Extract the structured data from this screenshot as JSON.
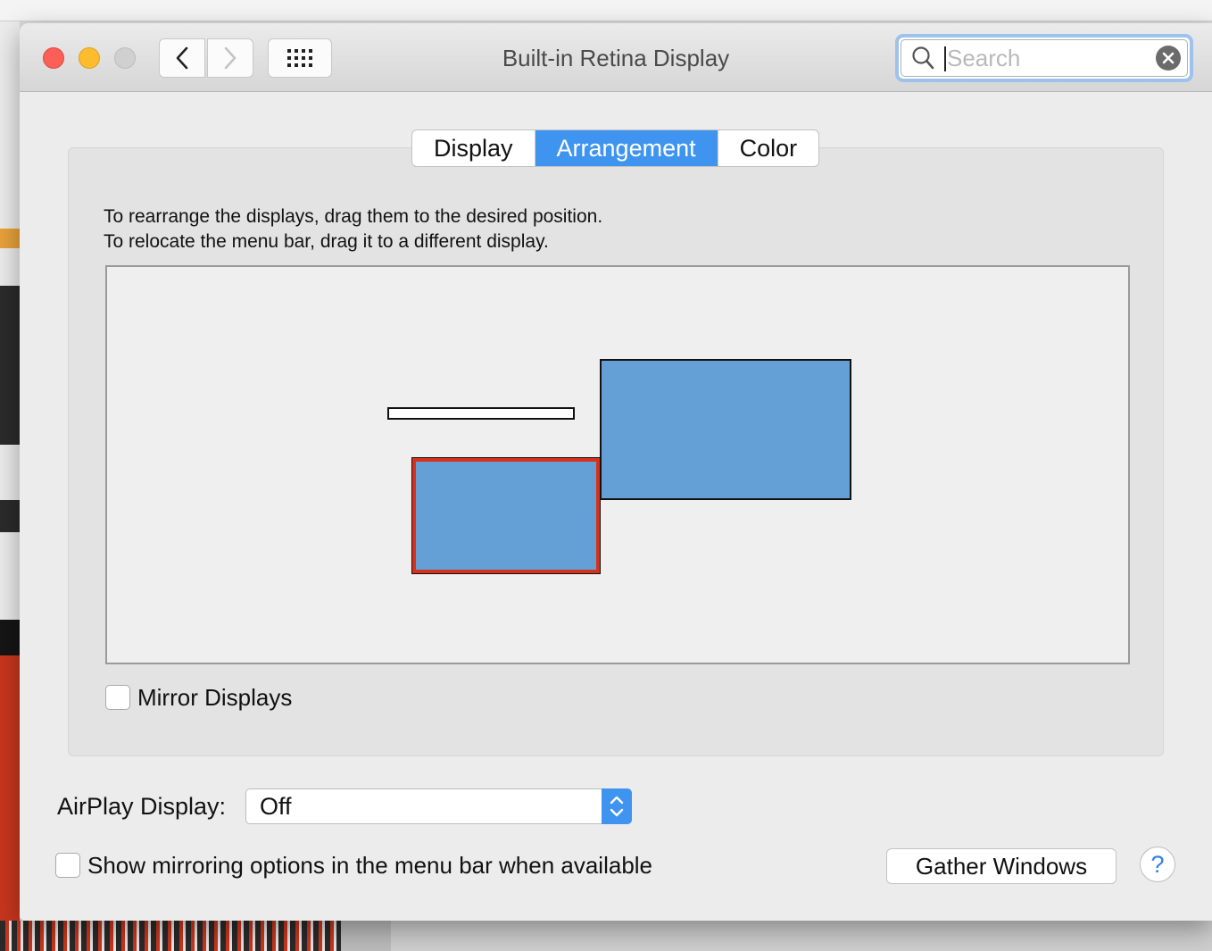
{
  "window": {
    "title": "Built-in Retina Display"
  },
  "search": {
    "placeholder": "Search",
    "value": ""
  },
  "tabs": [
    {
      "label": "Display",
      "active": false
    },
    {
      "label": "Arrangement",
      "active": true
    },
    {
      "label": "Color",
      "active": false
    }
  ],
  "arrangement": {
    "instruction_line1": "To rearrange the displays, drag them to the desired position.",
    "instruction_line2": "To relocate the menu bar, drag it to a different display.",
    "displays": [
      {
        "role": "built-in",
        "selected": true,
        "color": "#649fd6",
        "highlight": "#d7311c"
      },
      {
        "role": "external",
        "selected": false,
        "color": "#649fd6"
      }
    ]
  },
  "mirror": {
    "label": "Mirror Displays",
    "checked": false
  },
  "airplay": {
    "label": "AirPlay Display:",
    "value": "Off"
  },
  "show_mirroring": {
    "label": "Show mirroring options in the menu bar when available",
    "checked": false
  },
  "buttons": {
    "gather": "Gather Windows",
    "help": "?"
  },
  "colors": {
    "accent": "#3f94f0",
    "close": "#fc5f57",
    "minimize": "#fdbc2e",
    "zoom_disabled": "#d0d0d0",
    "search_focus": "#9ec2ee"
  },
  "icons": {
    "back": "chevron-left-icon",
    "forward": "chevron-right-icon",
    "show_all": "grid-icon",
    "search": "search-icon",
    "clear": "clear-icon",
    "popup": "updown-chevron-icon"
  }
}
